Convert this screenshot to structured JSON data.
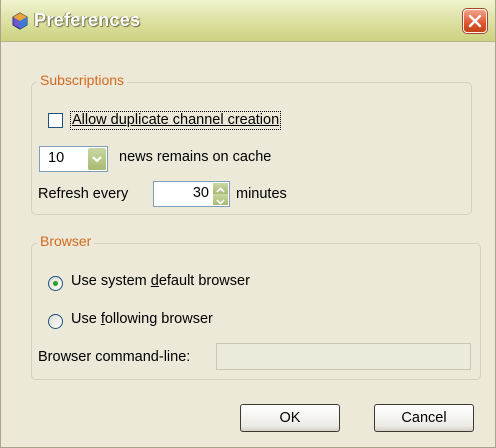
{
  "window": {
    "title": "Preferences",
    "close_icon": "close-icon",
    "app_icon": "app-icon"
  },
  "subscriptions": {
    "legend": "Subscriptions",
    "allow_duplicate_label": "Allow duplicate channel creation",
    "allow_duplicate_checked": false,
    "cache_count_value": "10",
    "cache_label": "news remains on cache",
    "refresh_prefix": "Refresh every",
    "refresh_value": "30",
    "refresh_suffix": "minutes"
  },
  "browser": {
    "legend": "Browser",
    "system_default_label_pre": "Use system ",
    "system_default_label_u": "d",
    "system_default_label_post": "efault browser",
    "system_default_selected": true,
    "following_label_pre": "Use ",
    "following_label_u": "f",
    "following_label_post": "ollowing browser",
    "following_selected": false,
    "command_line_label": "Browser command-line:",
    "command_line_value": ""
  },
  "buttons": {
    "ok_label": "OK",
    "cancel_label": "Cancel"
  },
  "colors": {
    "accent_legend": "#d2691e",
    "window_bg": "#ece9d8",
    "titlebar": "#dfe3a8",
    "close": "#dd5730"
  }
}
